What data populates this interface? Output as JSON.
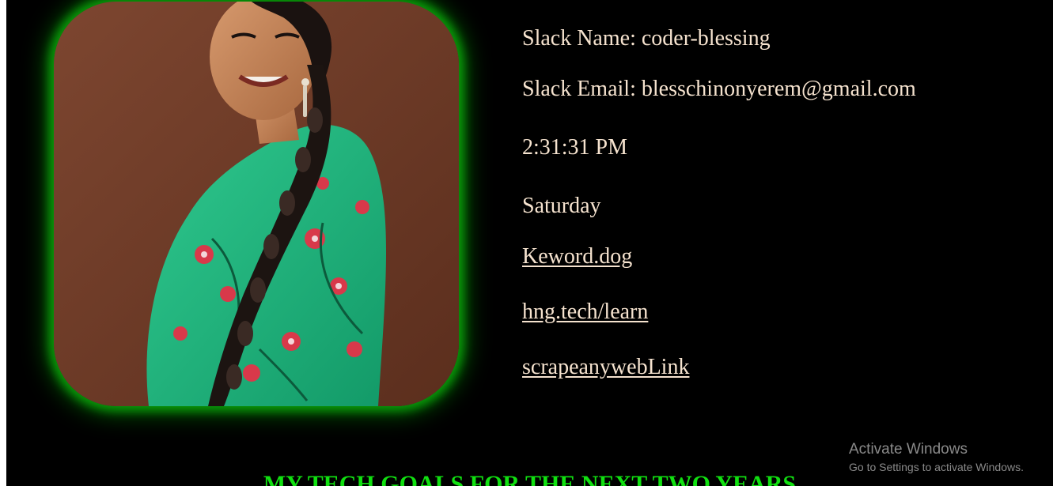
{
  "profile": {
    "image_alt": "coder-blessing profile photo",
    "slack_name": "Slack Name: coder-blessing",
    "slack_email": "Slack Email: blesschinonyerem@gmail.com",
    "time": "2:31:31 PM",
    "day": "Saturday"
  },
  "links": [
    {
      "label": "Keword.dog"
    },
    {
      "label": "hng.tech/learn"
    },
    {
      "label": "scrapeanywebLink"
    }
  ],
  "goals": {
    "title": "MY TECH GOALS FOR THE NEXT TWO YEARS"
  },
  "watermark": {
    "line1": "Activate Windows",
    "line2": "Go to Settings to activate Windows."
  },
  "colors": {
    "background": "#000000",
    "text": "#f6e3cf",
    "accent_green": "#11e011",
    "glow": "#0a9a0a"
  }
}
